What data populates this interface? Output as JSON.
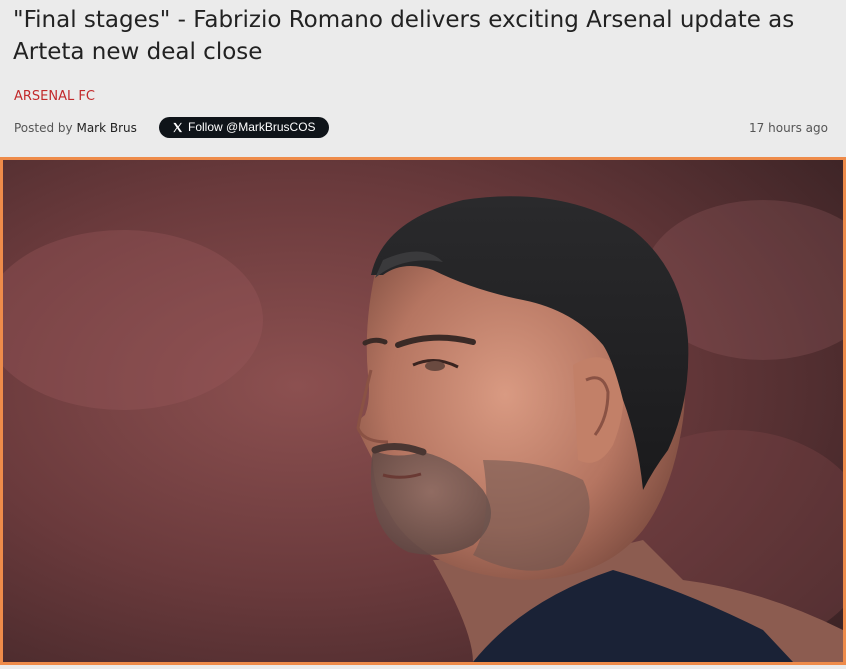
{
  "article": {
    "headline": "\"Final stages\" - Fabrizio Romano delivers exciting Arsenal update as Arteta new deal close",
    "category": "ARSENAL FC",
    "posted_by_label": "Posted by",
    "author": "Mark Brus",
    "follow_button": "Follow @MarkBrusCOS",
    "time_ago": "17 hours ago"
  },
  "hero_image": {
    "icon": "photo-of-man-profile",
    "border_color": "#ee8b4a"
  },
  "colors": {
    "category": "#c2292b",
    "follow_button_bg": "#0f1419",
    "page_bg": "#ebebeb"
  }
}
